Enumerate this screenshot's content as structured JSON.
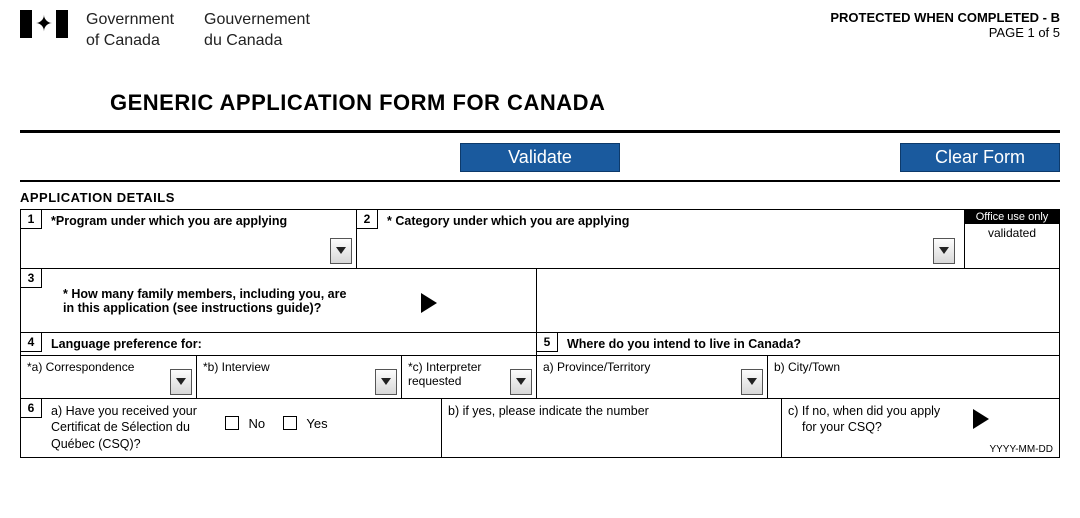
{
  "header": {
    "gov_en_line1": "Government",
    "gov_en_line2": "of Canada",
    "gov_fr_line1": "Gouvernement",
    "gov_fr_line2": "du Canada",
    "protected": "PROTECTED WHEN COMPLETED - B",
    "page": "PAGE 1 of 5"
  },
  "title": "GENERIC APPLICATION FORM FOR CANADA",
  "buttons": {
    "validate": "Validate",
    "clear": "Clear Form"
  },
  "section": {
    "app_details": "APPLICATION DETAILS"
  },
  "fields": {
    "q1": {
      "num": "1",
      "label": "*Program under which you are applying"
    },
    "q2": {
      "num": "2",
      "label": "* Category under which you are applying"
    },
    "office": {
      "head": "Office use only",
      "body": "validated"
    },
    "q3": {
      "num": "3",
      "label_l1": "* How many family members, including you, are",
      "label_l2": "in this application (see instructions guide)?"
    },
    "q4": {
      "num": "4",
      "label": "Language preference for:",
      "a": "*a) Correspondence",
      "b": "*b) Interview",
      "c": "*c) Interpreter requested"
    },
    "q5": {
      "num": "5",
      "label": "Where do you intend to live in Canada?",
      "a": "a) Province/Territory",
      "b": "b) City/Town"
    },
    "q6": {
      "num": "6",
      "a_l1": "a) Have you received your",
      "a_l2": "Certificat de Sélection du",
      "a_l3": "Québec (CSQ)?",
      "no": "No",
      "yes": "Yes",
      "b": "b) if yes, please indicate the number",
      "c_l1": "c) If no, when did you apply",
      "c_l2": "for your CSQ?",
      "date_hint": "YYYY-MM-DD"
    }
  }
}
